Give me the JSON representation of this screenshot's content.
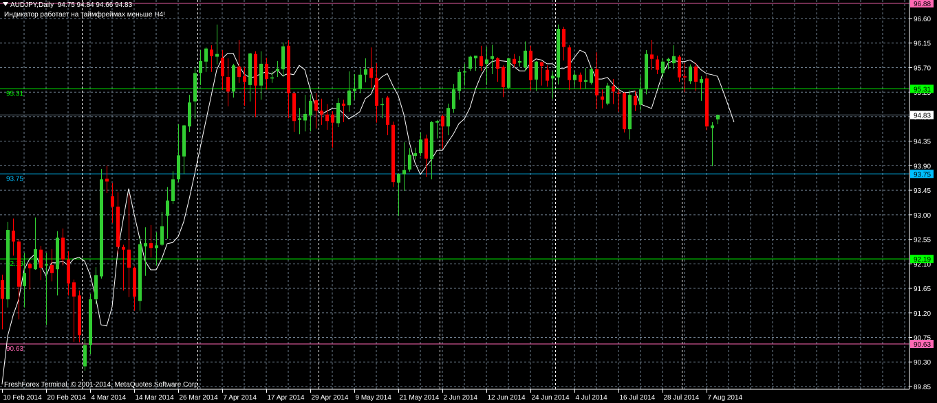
{
  "header": {
    "symbol": "AUDJPY,Daily",
    "ohlc": "94.75 94.84 94.66 94.83",
    "notice": "Индикатор работает на таймфреймах меньше H4!",
    "copyright": "FreshForex Terminal, © 2001-2014, MetaQuotes Software Corp."
  },
  "colors": {
    "background": "#000000",
    "bull": "#32CD32",
    "bear": "#FF0000",
    "grid": "#708090",
    "ma": "#FFFFFF",
    "axis": "#FFFFFF"
  },
  "chart_data": {
    "type": "candlestick",
    "title": "AUDJPY,Daily",
    "ylim": [
      89.85,
      96.88
    ],
    "y_ticks": [
      "96.60",
      "96.15",
      "95.70",
      "95.25",
      "94.80",
      "94.35",
      "93.90",
      "93.45",
      "93.00",
      "92.55",
      "92.10",
      "91.65",
      "91.20",
      "90.75",
      "90.30",
      "89.85"
    ],
    "x_labels": [
      {
        "bar": 0,
        "label": "10 Feb 2014"
      },
      {
        "bar": 8,
        "label": "20 Feb 2014"
      },
      {
        "bar": 16,
        "label": "4 Mar 2014"
      },
      {
        "bar": 24,
        "label": "14 Mar 2014"
      },
      {
        "bar": 32,
        "label": "26 Mar 2014"
      },
      {
        "bar": 40,
        "label": "7 Apr 2014"
      },
      {
        "bar": 48,
        "label": "17 Apr 2014"
      },
      {
        "bar": 56,
        "label": "29 Apr 2014"
      },
      {
        "bar": 64,
        "label": "9 May 2014"
      },
      {
        "bar": 72,
        "label": "21 May 2014"
      },
      {
        "bar": 80,
        "label": "2 Jun 2014"
      },
      {
        "bar": 88,
        "label": "12 Jun 2014"
      },
      {
        "bar": 96,
        "label": "24 Jun 2014"
      },
      {
        "bar": 104,
        "label": "4 Jul 2014"
      },
      {
        "bar": 112,
        "label": "16 Jul 2014"
      },
      {
        "bar": 120,
        "label": "28 Jul 2014"
      },
      {
        "bar": 128,
        "label": "7 Aug 2014"
      }
    ],
    "month_separators": [
      15,
      36,
      58,
      80,
      101,
      124
    ],
    "levels": [
      {
        "price": 96.88,
        "label": "96.88",
        "color": "#FF69B4",
        "left_label": false
      },
      {
        "price": 95.31,
        "label": "95.31",
        "color": "#00FF00",
        "left_label": true
      },
      {
        "price": 93.75,
        "label": "93.75",
        "color": "#00BFFF",
        "left_label": true
      },
      {
        "price": 92.19,
        "label": "92.19",
        "color": "#00FF00",
        "left_label": true
      },
      {
        "price": 90.63,
        "label": "90.63",
        "color": "#FF69B4",
        "left_label": true
      }
    ],
    "current_price": {
      "price": 94.83,
      "label": "94.83",
      "color": "#778899"
    },
    "ohlc": [
      [
        91.8,
        91.9,
        90.9,
        91.46
      ],
      [
        91.45,
        92.87,
        91.3,
        92.72
      ],
      [
        92.71,
        92.93,
        92.25,
        92.51
      ],
      [
        92.51,
        92.55,
        91.08,
        91.68
      ],
      [
        91.69,
        92.3,
        91.3,
        91.93
      ],
      [
        92.1,
        92.13,
        91.63,
        92.02
      ],
      [
        92.0,
        92.95,
        91.99,
        92.37
      ],
      [
        92.36,
        92.43,
        91.8,
        92.03
      ],
      [
        92.07,
        92.3,
        90.98,
        92.09
      ],
      [
        92.08,
        92.37,
        91.78,
        91.93
      ],
      [
        92.0,
        92.7,
        91.52,
        92.58
      ],
      [
        92.58,
        92.75,
        92.07,
        92.18
      ],
      [
        92.18,
        92.33,
        91.52,
        91.74
      ],
      [
        91.76,
        91.81,
        90.67,
        91.5
      ],
      [
        91.52,
        91.61,
        90.66,
        90.79
      ],
      [
        90.22,
        90.72,
        90.14,
        90.61
      ],
      [
        90.61,
        91.55,
        90.44,
        91.45
      ],
      [
        91.45,
        92.04,
        91.36,
        91.89
      ],
      [
        91.87,
        93.84,
        91.83,
        93.65
      ],
      [
        93.66,
        93.9,
        93.4,
        93.61
      ],
      [
        93.34,
        93.58,
        92.85,
        93.15
      ],
      [
        93.15,
        93.41,
        92.28,
        92.41
      ],
      [
        92.41,
        92.45,
        91.61,
        92.36
      ],
      [
        92.36,
        93.38,
        91.49,
        92.03
      ],
      [
        92.03,
        92.05,
        91.24,
        91.5
      ],
      [
        91.42,
        92.6,
        91.24,
        92.46
      ],
      [
        92.42,
        92.77,
        91.88,
        92.48
      ],
      [
        92.48,
        92.81,
        92.22,
        92.39
      ],
      [
        92.39,
        92.68,
        92.07,
        92.44
      ],
      [
        92.45,
        93.05,
        92.43,
        92.79
      ],
      [
        92.98,
        93.51,
        92.56,
        93.26
      ],
      [
        93.25,
        93.8,
        93.2,
        93.65
      ],
      [
        93.65,
        94.66,
        93.6,
        94.09
      ],
      [
        94.07,
        94.65,
        93.75,
        94.64
      ],
      [
        94.62,
        95.2,
        94.52,
        95.06
      ],
      [
        95.08,
        95.71,
        94.76,
        95.6
      ],
      [
        95.6,
        96.02,
        95.38,
        95.82
      ],
      [
        95.81,
        96.07,
        95.62,
        96.05
      ],
      [
        96.03,
        96.11,
        95.62,
        95.91
      ],
      [
        95.9,
        96.49,
        95.76,
        95.95
      ],
      [
        95.88,
        96.02,
        95.29,
        95.54
      ],
      [
        95.53,
        95.87,
        94.99,
        95.26
      ],
      [
        95.26,
        95.77,
        95.15,
        95.74
      ],
      [
        95.72,
        96.21,
        95.42,
        95.53
      ],
      [
        95.54,
        95.71,
        95.0,
        95.44
      ],
      [
        95.38,
        95.97,
        95.08,
        95.96
      ],
      [
        95.95,
        96.0,
        94.79,
        95.37
      ],
      [
        95.37,
        96.0,
        95.11,
        95.77
      ],
      [
        95.77,
        95.88,
        95.3,
        95.49
      ],
      [
        95.5,
        95.63,
        95.42,
        95.52
      ],
      [
        95.64,
        95.82,
        95.53,
        95.68
      ],
      [
        95.67,
        96.16,
        95.53,
        96.09
      ],
      [
        96.1,
        96.21,
        94.77,
        95.23
      ],
      [
        95.23,
        95.24,
        94.52,
        94.72
      ],
      [
        94.74,
        94.96,
        94.48,
        94.77
      ],
      [
        94.73,
        95.2,
        94.53,
        94.85
      ],
      [
        94.82,
        95.21,
        94.53,
        95.09
      ],
      [
        95.1,
        95.23,
        94.58,
        94.91
      ],
      [
        94.91,
        95.13,
        94.65,
        94.84
      ],
      [
        94.84,
        95.03,
        94.56,
        94.72
      ],
      [
        94.84,
        94.9,
        94.23,
        94.69
      ],
      [
        94.68,
        95.14,
        94.61,
        95.05
      ],
      [
        95.04,
        95.11,
        94.7,
        95.0
      ],
      [
        95.01,
        95.63,
        94.89,
        95.28
      ],
      [
        95.27,
        95.58,
        95.11,
        95.31
      ],
      [
        95.31,
        95.69,
        95.23,
        95.57
      ],
      [
        95.57,
        95.87,
        95.43,
        95.67
      ],
      [
        95.69,
        96.07,
        95.33,
        95.51
      ],
      [
        95.51,
        95.78,
        94.69,
        95.0
      ],
      [
        95.02,
        95.14,
        94.77,
        95.03
      ],
      [
        95.15,
        95.18,
        94.46,
        94.65
      ],
      [
        94.65,
        94.71,
        93.51,
        93.6
      ],
      [
        93.59,
        93.76,
        92.98,
        93.75
      ],
      [
        93.74,
        94.33,
        93.44,
        93.82
      ],
      [
        93.83,
        94.22,
        93.79,
        94.1
      ],
      [
        94.08,
        94.23,
        94.01,
        94.13
      ],
      [
        94.13,
        94.51,
        94.08,
        94.38
      ],
      [
        94.4,
        94.47,
        93.69,
        94.03
      ],
      [
        94.02,
        94.72,
        93.65,
        94.7
      ],
      [
        94.69,
        94.74,
        94.4,
        94.72
      ],
      [
        94.81,
        94.84,
        94.21,
        94.62
      ],
      [
        94.62,
        95.04,
        94.46,
        94.96
      ],
      [
        94.94,
        95.4,
        94.87,
        95.3
      ],
      [
        95.27,
        95.67,
        95.11,
        95.62
      ],
      [
        95.62,
        95.77,
        95.37,
        95.63
      ],
      [
        95.68,
        95.92,
        95.64,
        95.9
      ],
      [
        95.87,
        95.92,
        95.64,
        95.92
      ],
      [
        95.91,
        96.1,
        95.64,
        95.73
      ],
      [
        95.77,
        96.08,
        95.38,
        95.85
      ],
      [
        95.86,
        96.12,
        95.58,
        95.91
      ],
      [
        95.87,
        95.89,
        95.44,
        95.68
      ],
      [
        95.71,
        95.74,
        95.16,
        95.34
      ],
      [
        95.33,
        95.88,
        95.32,
        95.87
      ],
      [
        95.86,
        95.95,
        95.71,
        95.77
      ],
      [
        95.79,
        95.91,
        95.72,
        95.82
      ],
      [
        95.7,
        96.18,
        95.64,
        96.01
      ],
      [
        96.01,
        96.1,
        95.28,
        95.47
      ],
      [
        95.48,
        95.82,
        95.27,
        95.81
      ],
      [
        95.8,
        95.81,
        95.37,
        95.73
      ],
      [
        95.66,
        95.74,
        95.35,
        95.46
      ],
      [
        95.5,
        95.63,
        95.13,
        95.55
      ],
      [
        95.52,
        96.49,
        95.39,
        96.41
      ],
      [
        96.41,
        96.45,
        95.83,
        96.08
      ],
      [
        96.07,
        96.11,
        95.29,
        95.47
      ],
      [
        95.47,
        95.63,
        95.35,
        95.57
      ],
      [
        95.57,
        95.61,
        95.3,
        95.44
      ],
      [
        95.44,
        95.69,
        95.32,
        95.47
      ],
      [
        95.42,
        95.71,
        95.39,
        95.67
      ],
      [
        95.67,
        95.98,
        94.94,
        95.19
      ],
      [
        95.17,
        95.3,
        94.95,
        95.11
      ],
      [
        95.04,
        95.42,
        95.01,
        95.37
      ],
      [
        95.36,
        95.49,
        95.03,
        95.26
      ],
      [
        95.24,
        95.3,
        94.89,
        95.22
      ],
      [
        95.23,
        95.25,
        94.51,
        94.57
      ],
      [
        94.57,
        95.28,
        94.38,
        95.2
      ],
      [
        95.18,
        95.27,
        94.9,
        95.01
      ],
      [
        95.02,
        95.55,
        94.91,
        95.3
      ],
      [
        95.3,
        96.02,
        95.21,
        95.95
      ],
      [
        95.94,
        96.21,
        95.66,
        95.86
      ],
      [
        95.85,
        95.92,
        95.58,
        95.66
      ],
      [
        95.6,
        95.87,
        95.52,
        95.81
      ],
      [
        95.82,
        95.88,
        95.67,
        95.86
      ],
      [
        95.78,
        96.11,
        95.67,
        95.91
      ],
      [
        95.9,
        95.93,
        95.44,
        95.52
      ],
      [
        95.54,
        95.78,
        95.25,
        95.52
      ],
      [
        95.45,
        95.76,
        95.4,
        95.72
      ],
      [
        95.72,
        95.79,
        95.27,
        95.44
      ],
      [
        95.42,
        95.54,
        95.09,
        95.49
      ],
      [
        95.5,
        95.55,
        94.55,
        94.62
      ],
      [
        94.59,
        94.7,
        93.89,
        94.64
      ],
      [
        94.75,
        94.84,
        94.66,
        94.83
      ]
    ],
    "ma": [
      89.89,
      90.77,
      91.15,
      91.44,
      91.99,
      92.19,
      92.28,
      92.07,
      91.88,
      92.12,
      92.12,
      92.15,
      92.07,
      92.19,
      92.22,
      92.15,
      91.9,
      91.49,
      90.98,
      90.96,
      91.31,
      92.32,
      92.91,
      93.48,
      93.01,
      92.57,
      92.15,
      91.99,
      91.99,
      92.19,
      92.47,
      92.49,
      92.6,
      92.87,
      93.29,
      93.75,
      94.23,
      94.71,
      95.18,
      95.66,
      95.87,
      95.96,
      95.96,
      95.74,
      95.58,
      95.52,
      95.53,
      95.59,
      95.62,
      95.58,
      95.66,
      95.55,
      95.59,
      95.57,
      95.74,
      95.66,
      95.3,
      94.96,
      94.84,
      94.9,
      94.95,
      94.95,
      94.86,
      94.76,
      94.82,
      94.89,
      95.13,
      95.21,
      95.43,
      95.53,
      95.59,
      95.37,
      95.18,
      94.84,
      94.33,
      93.96,
      93.74,
      93.88,
      94.01,
      94.18,
      94.18,
      94.33,
      94.48,
      94.67,
      94.76,
      94.96,
      95.3,
      95.55,
      95.72,
      95.81,
      95.83,
      95.82,
      95.81,
      95.72,
      95.64,
      95.64,
      95.78,
      95.86,
      95.84,
      95.77,
      95.77,
      95.69,
      95.68,
      95.74,
      95.89,
      96.02,
      95.97,
      95.71,
      95.49,
      95.49,
      95.52,
      95.4,
      95.3,
      95.24,
      95.25,
      95.27,
      95.03,
      94.99,
      94.95,
      95.27,
      95.58,
      95.78,
      95.83,
      95.81,
      95.81,
      95.84,
      95.77,
      95.66,
      95.59,
      95.57,
      95.54,
      95.27,
      94.99,
      94.7
    ]
  }
}
